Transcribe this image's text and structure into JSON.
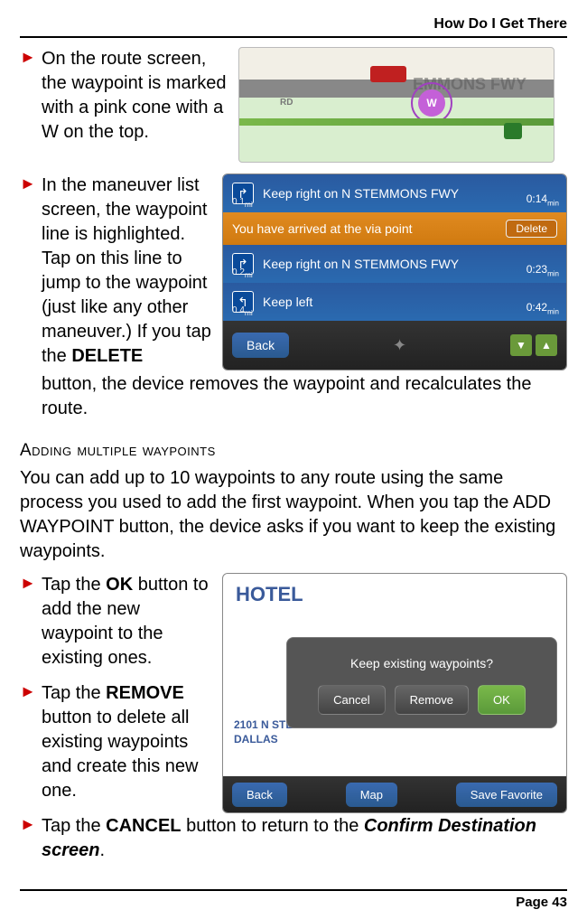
{
  "header": "How Do I Get There",
  "footer": "Page 43",
  "bullets": {
    "b1": "On the route screen, the waypoint is marked with a pink cone with a W on the top.",
    "b2_part1": "In the maneuver list screen, the waypoint line is highlighted. Tap on this line to jump to the waypoint (just like any other maneuver.) If you tap the ",
    "b2_bold": "DELETE",
    "b2_part2": " button, the device removes the waypoint and recalculates the route.",
    "b3_part1": "Tap the ",
    "b3_bold": "OK",
    "b3_part2": " button to add the new waypoint to the existing ones.",
    "b4_part1": "Tap the ",
    "b4_bold": "REMOVE",
    "b4_part2": " button to delete all existing waypoints and create this new one.",
    "b5_part1": "Tap the ",
    "b5_bold": "CANCEL",
    "b5_part2": " button to return to the ",
    "b5_italic": "Confirm Destination screen",
    "b5_part3": "."
  },
  "subhead": "Adding multiple waypoints",
  "para_part1": "You can add up to 10 waypoints to any route using the same process you used to add the first waypoint. When you tap the ",
  "para_bold": "ADD WAYPOINT",
  "para_part2": " button, the device asks if you want to keep the existing waypoints.",
  "screenshot1": {
    "road_label": "EMMONS FWY",
    "rd_label": "RD",
    "cone_letter": "W"
  },
  "screenshot2": {
    "rows": [
      {
        "text": "Keep right on N STEMMONS FWY",
        "dist": "0.1",
        "dist_unit": "mi",
        "time": "0:14",
        "time_unit": "min"
      },
      {
        "text": "You have arrived at the via point",
        "delete_label": "Delete"
      },
      {
        "text": "Keep right on N STEMMONS FWY",
        "dist": "0.2",
        "dist_unit": "mi",
        "time": "0:23",
        "time_unit": "min"
      },
      {
        "text": "Keep left",
        "dist": "0.4",
        "dist_unit": "mi",
        "time": "0:42",
        "time_unit": "min"
      }
    ],
    "back": "Back"
  },
  "screenshot3": {
    "title": "HOTEL",
    "addr1": "2101 N STE",
    "addr2": "DALLAS",
    "question": "Keep existing waypoints?",
    "cancel": "Cancel",
    "remove": "Remove",
    "ok": "OK",
    "back": "Back",
    "map": "Map",
    "save": "Save Favorite"
  }
}
